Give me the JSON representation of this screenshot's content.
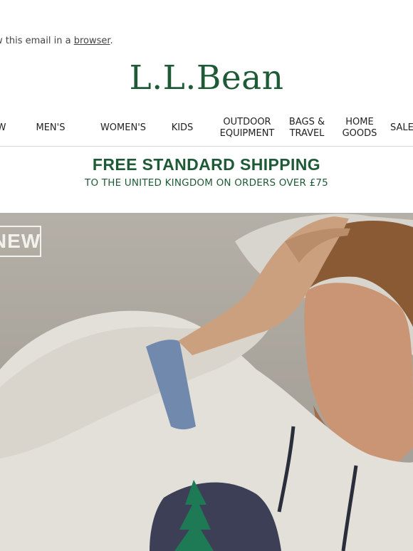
{
  "preheader": {
    "text": "w this email in a ",
    "link": "browser",
    "suffix": "."
  },
  "brand": {
    "logo_text": "L.L.Bean"
  },
  "nav": {
    "items": [
      {
        "label": "W"
      },
      {
        "label": "MEN'S"
      },
      {
        "label": "WOMEN'S"
      },
      {
        "label": "KIDS"
      },
      {
        "label": "OUTDOOR\nEQUIPMENT"
      },
      {
        "label": "BAGS &\nTRAVEL"
      },
      {
        "label": "HOME\nGOODS"
      },
      {
        "label": "SALE"
      }
    ]
  },
  "shipping": {
    "title": "FREE STANDARD SHIPPING",
    "subtitle": "TO THE UNITED KINGDOM ON ORDERS OVER £75"
  },
  "hero": {
    "badge": "NEW"
  },
  "colors": {
    "brand_green": "#1f5a36",
    "hero_background": "#aca79e",
    "sweatshirt": "#e3e0da"
  }
}
